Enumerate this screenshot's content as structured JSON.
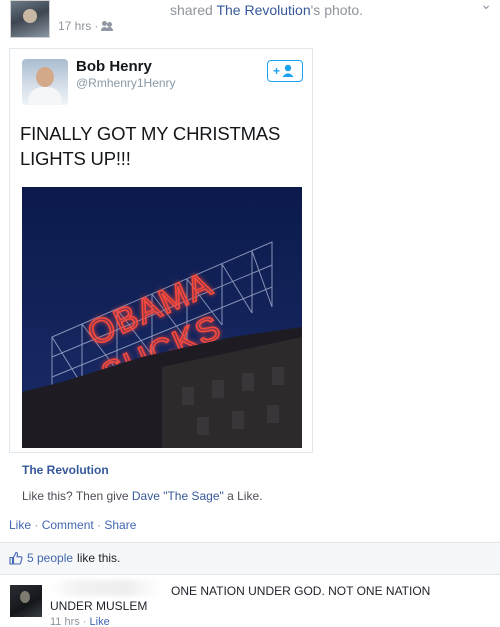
{
  "post": {
    "shared_prefix": "shared ",
    "shared_page": "The Revolution",
    "shared_suffix": "'s photo.",
    "time": "17 hrs",
    "separator": " · ",
    "audience_icon": "friends-icon",
    "menu_icon": "chevron-down-icon"
  },
  "tweet": {
    "name": "Bob Henry",
    "handle": "@Rmhenry1Henry",
    "follow_icon": "follow-plus-icon",
    "text": "FINALLY GOT MY CHRISTMAS LIGHTS UP!!!",
    "photo": {
      "sign_line1": "OBAMA",
      "sign_line2": "SUCKS",
      "sign_color": "#ff3b2f"
    }
  },
  "page_info": {
    "name": "The Revolution",
    "caption_prefix": "Like this? Then give ",
    "caption_link": "Dave \"The Sage\"",
    "caption_suffix": " a Like."
  },
  "actions": {
    "like": "Like",
    "comment": "Comment",
    "share": "Share",
    "separator": " · "
  },
  "likes": {
    "count_text": "5 people",
    "rest_text": " like this.",
    "icon": "thumbs-up-icon"
  },
  "comment": {
    "line1": "ONE NATION UNDER GOD. NOT ONE NATION",
    "line2": "UNDER MUSLEM",
    "time": "11 hrs",
    "separator": " · ",
    "like": "Like"
  },
  "colors": {
    "link": "#365899",
    "action": "#4267b2",
    "meta": "#90949c",
    "twitter_blue": "#1da1f2"
  }
}
